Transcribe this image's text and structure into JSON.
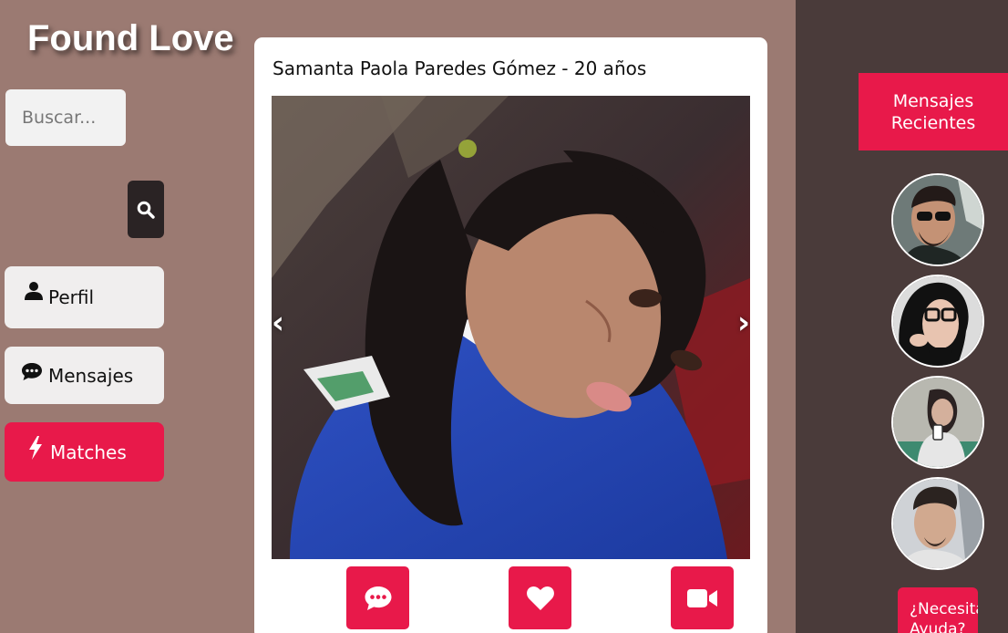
{
  "app": {
    "title": "Found Love"
  },
  "search": {
    "placeholder": "Buscar..."
  },
  "nav": {
    "profile": "Perfil",
    "messages": "Mensajes",
    "matches": "Matches"
  },
  "profile_card": {
    "title": "Samanta Paola Paredes Gómez - 20 años",
    "prev_arrow": "‹",
    "next_arrow": "›"
  },
  "recent_messages": {
    "header": "Mensajes Recientes",
    "avatars": [
      "avatar-1",
      "avatar-2",
      "avatar-3",
      "avatar-4"
    ]
  },
  "help": {
    "label": "¿Necesitas Ayuda?"
  },
  "colors": {
    "accent": "#e8194a",
    "page_background": "#9b7a72",
    "right_panel": "#4a3b3a",
    "search_button": "#2a2324"
  }
}
